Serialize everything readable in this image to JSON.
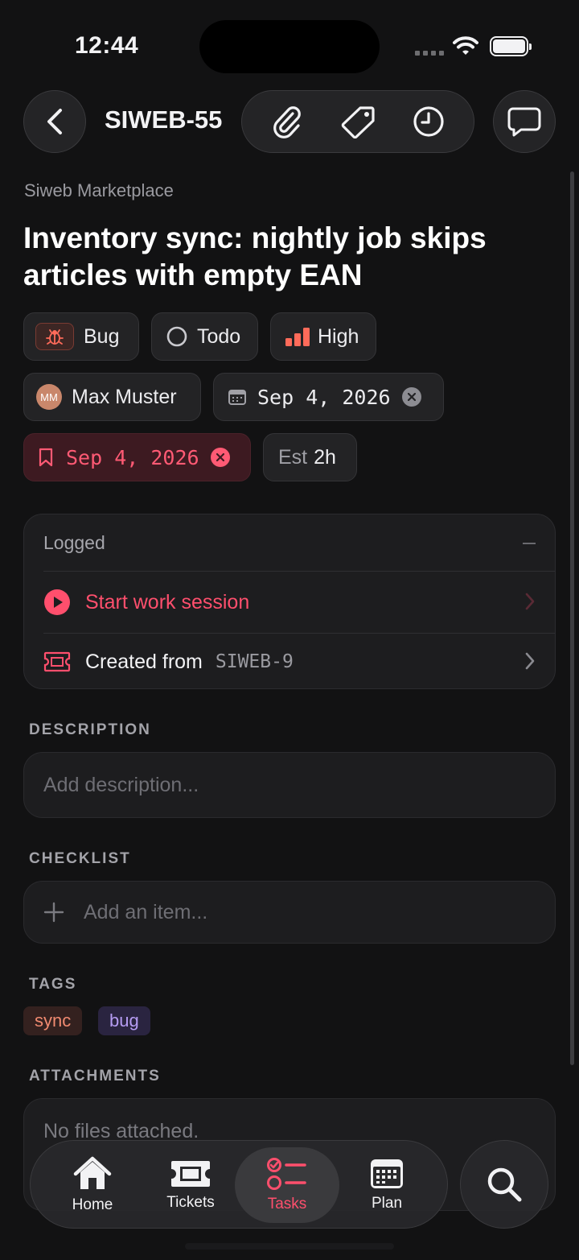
{
  "status_bar": {
    "time": "12:44"
  },
  "header": {
    "ticket_id": "SIWEB-55"
  },
  "project": "Siweb Marketplace",
  "title": "Inventory sync: nightly job skips articles with empty EAN",
  "chips": {
    "type": "Bug",
    "status": "Todo",
    "priority": "High",
    "assignee_initials": "MM",
    "assignee": "Max Muster",
    "start_date": "Sep 4, 2026",
    "due_date": "Sep 4, 2026",
    "estimate_label": "Est",
    "estimate_value": "2h"
  },
  "logged": {
    "heading": "Logged",
    "start_session": "Start work session",
    "created_from_label": "Created from",
    "created_from_ticket": "SIWEB-9"
  },
  "description": {
    "heading": "DESCRIPTION",
    "placeholder": "Add description..."
  },
  "checklist": {
    "heading": "CHECKLIST",
    "placeholder": "Add an item..."
  },
  "tags": {
    "heading": "TAGS",
    "items": [
      "sync",
      "bug"
    ]
  },
  "attachments": {
    "heading": "ATTACHMENTS",
    "empty": "No files attached."
  },
  "tabbar": {
    "items": [
      {
        "label": "Home",
        "icon": "home-icon"
      },
      {
        "label": "Tickets",
        "icon": "ticket-icon"
      },
      {
        "label": "Tasks",
        "icon": "tasks-icon",
        "active": true
      },
      {
        "label": "Plan",
        "icon": "calendar-icon"
      }
    ]
  },
  "colors": {
    "accent": "#ff4f6d",
    "background": "#121213",
    "card": "#1d1d1f",
    "priority_high": "#ff6b5a",
    "tag_sync": "#f08a70",
    "tag_bug": "#b59cf2"
  }
}
